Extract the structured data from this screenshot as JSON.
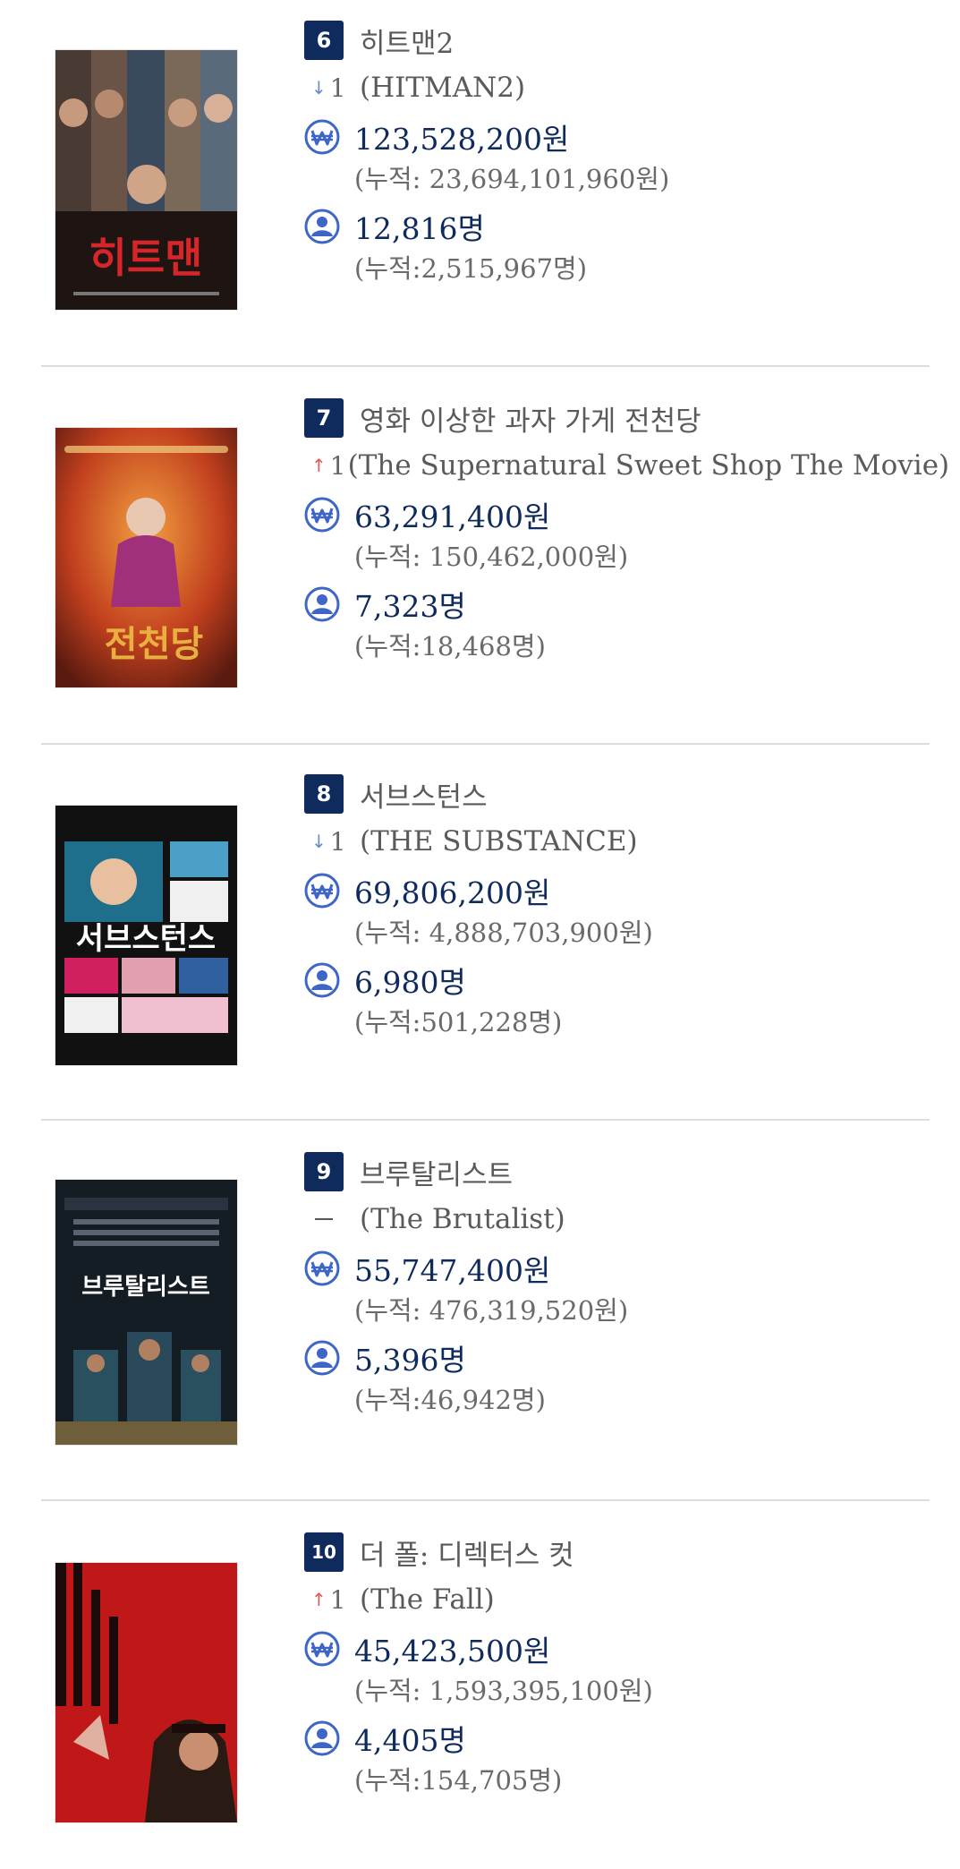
{
  "colors": {
    "badge": "#0f2a5c",
    "value": "#0f2a5c",
    "icon": "#3e65c8",
    "up": "#e05a5a",
    "down": "#6a8ad0",
    "divider": "#dcdcdc"
  },
  "icons": {
    "revenue": "won-currency-icon",
    "audience": "person-icon"
  },
  "movies": [
    {
      "rank": "6",
      "title_kr": "히트맨2",
      "title_en": "(HITMAN2)",
      "change_dir": "down",
      "change_val": "1",
      "revenue": "123,528,200원",
      "revenue_total": "(누적: 23,694,101,960원)",
      "audience": "12,816명",
      "audience_total": "(누적:2,515,967명)",
      "poster_text": "히트맨"
    },
    {
      "rank": "7",
      "title_kr": "영화 이상한 과자 가게 전천당",
      "title_en": "(The Supernatural Sweet Shop The Movie)",
      "change_dir": "up",
      "change_val": "1",
      "revenue": "63,291,400원",
      "revenue_total": "(누적: 150,462,000원)",
      "audience": "7,323명",
      "audience_total": "(누적:18,468명)",
      "poster_text": "전천당"
    },
    {
      "rank": "8",
      "title_kr": "서브스턴스",
      "title_en": "(THE SUBSTANCE)",
      "change_dir": "down",
      "change_val": "1",
      "revenue": "69,806,200원",
      "revenue_total": "(누적: 4,888,703,900원)",
      "audience": "6,980명",
      "audience_total": "(누적:501,228명)",
      "poster_text": "서브스턴스"
    },
    {
      "rank": "9",
      "title_kr": "브루탈리스트",
      "title_en": "(The Brutalist)",
      "change_dir": "none",
      "change_val": "",
      "revenue": "55,747,400원",
      "revenue_total": "(누적: 476,319,520원)",
      "audience": "5,396명",
      "audience_total": "(누적:46,942명)",
      "poster_text": "브루탈리스트"
    },
    {
      "rank": "10",
      "title_kr": "더 폴: 디렉터스 컷",
      "title_en": "(The Fall)",
      "change_dir": "up",
      "change_val": "1",
      "revenue": "45,423,500원",
      "revenue_total": "(누적: 1,593,395,100원)",
      "audience": "4,405명",
      "audience_total": "(누적:154,705명)",
      "poster_text": ""
    }
  ]
}
